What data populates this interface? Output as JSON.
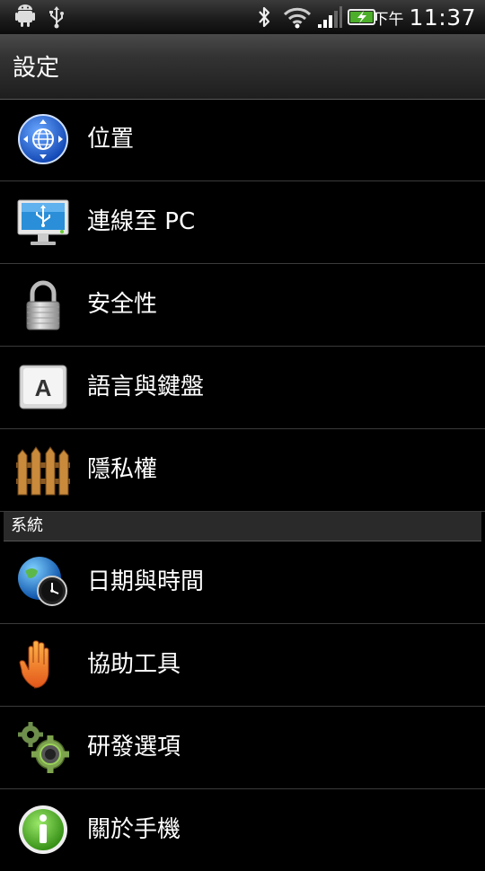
{
  "status_bar": {
    "ampm": "下午",
    "time": "11:37",
    "icons": [
      "android-debug-icon",
      "usb-icon",
      "bluetooth-icon",
      "wifi-icon",
      "signal-icon",
      "battery-charging-icon"
    ]
  },
  "title": "設定",
  "items_top": [
    {
      "label": "位置",
      "icon": "location-globe-icon"
    },
    {
      "label": "連線至 PC",
      "icon": "connect-pc-icon"
    },
    {
      "label": "安全性",
      "icon": "lock-icon"
    },
    {
      "label": "語言與鍵盤",
      "icon": "keyboard-key-icon"
    },
    {
      "label": "隱私權",
      "icon": "fence-icon"
    }
  ],
  "section_header": "系統",
  "items_system": [
    {
      "label": "日期與時間",
      "icon": "globe-clock-icon"
    },
    {
      "label": "協助工具",
      "icon": "hand-icon"
    },
    {
      "label": "研發選項",
      "icon": "gears-icon"
    },
    {
      "label": "關於手機",
      "icon": "info-icon"
    }
  ]
}
